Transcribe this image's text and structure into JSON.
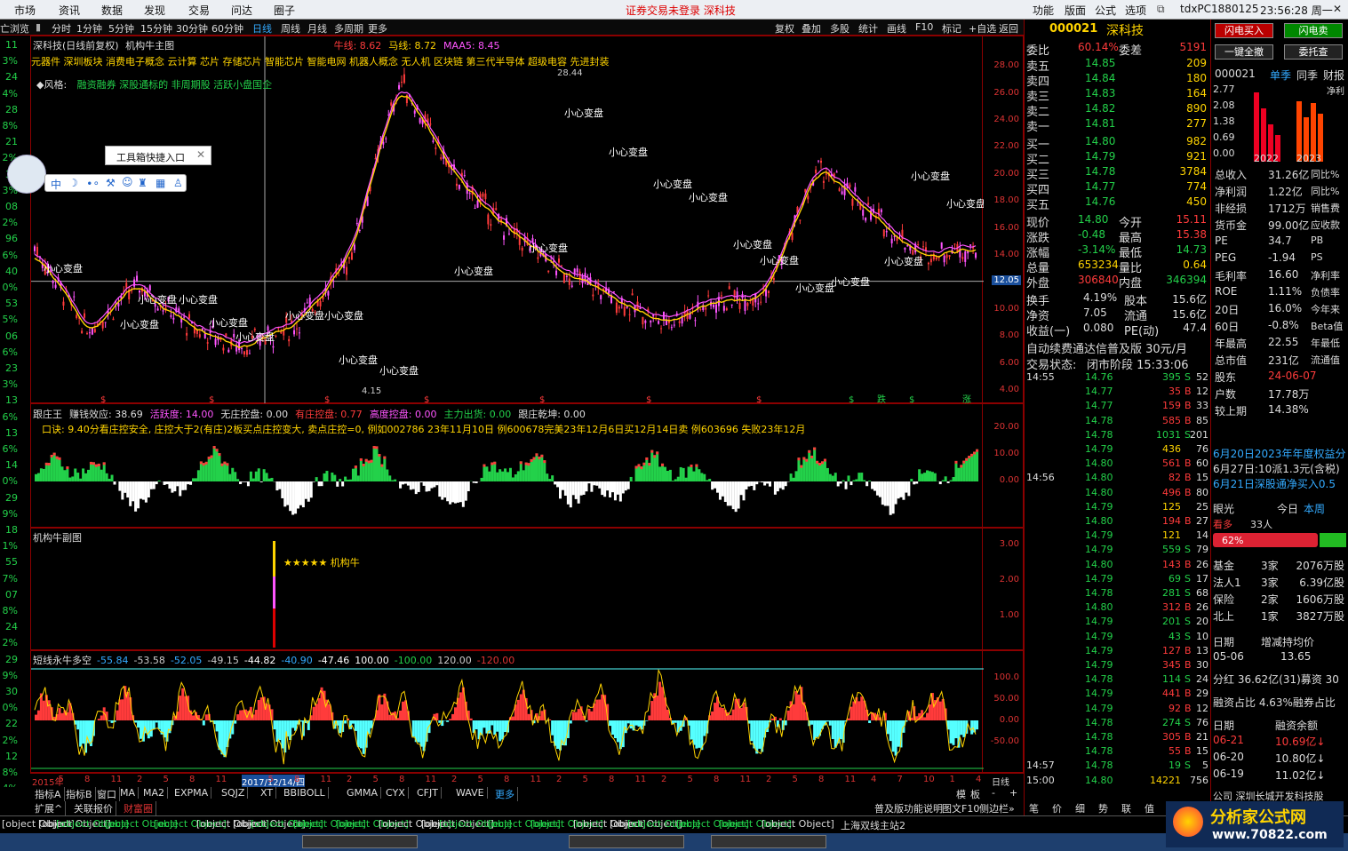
{
  "menu": {
    "items": [
      "市场",
      "资讯",
      "数据",
      "发现",
      "交易",
      "问达",
      "圈子"
    ],
    "center": "证券交易未登录  深科技",
    "right": [
      "功能",
      "版面",
      "公式",
      "选项"
    ],
    "account": "tdxPC1880125",
    "clock": "23:56:28 周一"
  },
  "toolbar": {
    "periods": [
      "分时",
      "1分钟",
      "5分钟",
      "15分钟",
      "30分钟",
      "60分钟",
      "日线",
      "周线",
      "月线",
      "多周期",
      "更多"
    ],
    "active_period": "日线",
    "tools": [
      "复权",
      "叠加",
      "多股",
      "统计",
      "画线",
      "F10",
      "标记",
      "+自选",
      "返回"
    ]
  },
  "left_column": {
    "label": "亡浏览",
    "values": [
      "11",
      "3%",
      "24",
      "4%",
      "28",
      "8%",
      "21",
      "2%",
      "36",
      "3%",
      "08",
      "2%",
      "96",
      "6%",
      "40",
      "0%",
      "53",
      "5%",
      "06",
      "6%",
      "23",
      "3%",
      "13",
      "6%",
      "13",
      "6%",
      "14",
      "0%",
      "29",
      "9%",
      "18",
      "1%",
      "55",
      "7%",
      "07",
      "8%",
      "24",
      "2%",
      "29",
      "9%",
      "30",
      "0%",
      "22",
      "2%",
      "12",
      "8%",
      "4%"
    ]
  },
  "main_chart": {
    "title": "深科技(日线前复权)",
    "indicator": "机构牛主图",
    "legend": [
      {
        "label": "牛线: 8.62",
        "color": "#ff3b3b"
      },
      {
        "label": "马线: 8.72",
        "color": "#ffd400"
      },
      {
        "label": "MAA5: 8.45",
        "color": "#ff55ff"
      }
    ],
    "concepts": "元器件 深圳板块 消费电子概念 云计算 芯片 存储芯片 智能芯片 智能电网 机器人概念 无人机 区块链 第三代半导体 超级电容 先进封装",
    "style_label": "◆风格:",
    "style_value": "融资融券 深股通标的 非周期股 活跃小盘国企",
    "annotations": [
      "小心变盘",
      "小心变盘",
      "小心变盘",
      "小心变盘",
      "小心变盘",
      "小心变盘",
      "小心变盘",
      "小心变盘",
      "小心变盘",
      "小心变盘",
      "小心变盘",
      "小心变盘",
      "小心变盘",
      "小心变盘",
      "小心变盘",
      "小心变盘"
    ],
    "high_label": "28.44",
    "low_label": "4.15",
    "crosshair_price": "12.05",
    "y_ticks": [
      "28.00",
      "26.00",
      "24.00",
      "22.00",
      "20.00",
      "18.00",
      "16.00",
      "14.00",
      "12.00",
      "10.00",
      "8.00",
      "6.00",
      "4.00"
    ],
    "markers": [
      "$",
      "$",
      "$",
      "$",
      "$",
      "$",
      "$",
      "$",
      "跌",
      "$",
      "涨",
      "减"
    ]
  },
  "chart_data": [
    {
      "type": "line",
      "title": "深科技(日线前复权)",
      "ylim": [
        4,
        29
      ],
      "x": [
        "2015",
        "2016",
        "2017",
        "2018",
        "2019",
        "2020",
        "2021",
        "2022",
        "2023",
        "2024"
      ],
      "series": [
        {
          "name": "牛线",
          "values": [
            14.6,
            8.4,
            11.8,
            8.6,
            7.2,
            8.8,
            13.5,
            27.0,
            20.0,
            16.0,
            13.0,
            11.0,
            9.0,
            10.5,
            11.2,
            20.5,
            17.0,
            14.0,
            14.6
          ]
        }
      ]
    },
    {
      "type": "bar",
      "title": "跟庄王",
      "ylim": [
        -5,
        21
      ],
      "y_ticks": [
        "20.00",
        "10.00",
        "0.00"
      ]
    },
    {
      "type": "bar",
      "title": "机构牛副图",
      "ylim": [
        0,
        3.2
      ],
      "y_ticks": [
        "3.00",
        "2.00",
        "1.00"
      ],
      "label": "★★★★★ 机构牛"
    },
    {
      "type": "area",
      "title": "短线永牛多空",
      "ylim": [
        -100,
        110
      ],
      "y_ticks": [
        "100.0",
        "50.00",
        "0.00",
        "-50.00"
      ]
    }
  ],
  "gzw": {
    "title": "跟庄王",
    "items": [
      {
        "t": "赚钱效应: 38.69",
        "c": "#ddd"
      },
      {
        "t": "活跃度: 14.00",
        "c": "#ff55ff"
      },
      {
        "t": "无庄控盘: 0.00",
        "c": "#ddd"
      },
      {
        "t": "有庄控盘: 0.77",
        "c": "#ff3b3b"
      },
      {
        "t": "高度控盘: 0.00",
        "c": "#ff55ff"
      },
      {
        "t": "主力出货: 0.00",
        "c": "#23d14a"
      },
      {
        "t": "跟庄乾坤: 0.00",
        "c": "#ddd"
      }
    ],
    "tip": "口诀: 9.40分看庄控安全, 庄控大于2(有庄)2板买点庄控变大, 卖点庄控=0, 例如002786 23年11月10日 例600678完美23年12月6日买12月14日卖 例603696 失败23年12月"
  },
  "jgn": {
    "title": "机构牛副图",
    "label": "★★★★★ 机构牛"
  },
  "dx": {
    "title": "短线永牛多空",
    "values": [
      "-55.84",
      "-53.58",
      "-52.05",
      "-49.15",
      "-44.82",
      "-40.90",
      "-47.46",
      "100.00",
      "-100.00",
      "120.00",
      "-120.00"
    ]
  },
  "date_axis": {
    "labels": [
      "2015年",
      "5",
      "8",
      "11",
      "2",
      "5",
      "8",
      "11",
      "2017/12/14/四",
      "5",
      "8",
      "11",
      "2",
      "5",
      "8",
      "11",
      "2",
      "5",
      "8",
      "11",
      "2",
      "5",
      "8",
      "11",
      "2",
      "5",
      "8",
      "11",
      "2",
      "5",
      "8",
      "11",
      "4",
      "7",
      "10",
      "1",
      "4"
    ],
    "period": "日线"
  },
  "bottom_tabs": {
    "row1": [
      "指标A",
      "指标B",
      "窗口",
      "MA",
      "MA2",
      "EXPMA",
      "SQJZ",
      "XT",
      "BBIBOLL",
      "GMMA",
      "CYX",
      "CFJT",
      "WAVE",
      "更多"
    ],
    "row2": [
      "扩展^",
      "关联报价",
      "财富圈"
    ],
    "right": [
      "模",
      "板",
      "-",
      "+"
    ]
  },
  "toolbox": {
    "title": "工具箱快捷入口"
  },
  "quote": {
    "code": "000021",
    "name": "深科技",
    "weibi": "委比",
    "weibi_val": "60.14%",
    "weicha": "委差",
    "weicha_val": "5191",
    "asks": [
      {
        "l": "卖五",
        "p": "14.85",
        "v": "209"
      },
      {
        "l": "卖四",
        "p": "14.84",
        "v": "180"
      },
      {
        "l": "卖三",
        "p": "14.83",
        "v": "164"
      },
      {
        "l": "卖二",
        "p": "14.82",
        "v": "890"
      },
      {
        "l": "卖一",
        "p": "14.81",
        "v": "277"
      }
    ],
    "bids": [
      {
        "l": "买一",
        "p": "14.80",
        "v": "982"
      },
      {
        "l": "买二",
        "p": "14.79",
        "v": "921"
      },
      {
        "l": "买三",
        "p": "14.78",
        "v": "3784"
      },
      {
        "l": "买四",
        "p": "14.77",
        "v": "774"
      },
      {
        "l": "买五",
        "p": "14.76",
        "v": "450"
      }
    ],
    "stats": [
      [
        "现价",
        "14.80",
        "今开",
        "15.11"
      ],
      [
        "涨跌",
        "-0.48",
        "最高",
        "15.38"
      ],
      [
        "涨幅",
        "-3.14%",
        "最低",
        "14.73"
      ],
      [
        "总量",
        "653234",
        "量比",
        "0.64"
      ],
      [
        "外盘",
        "306840",
        "内盘",
        "346394"
      ]
    ],
    "stats2": [
      [
        "换手",
        "4.19%",
        "股本",
        "15.6亿"
      ],
      [
        "净资",
        "7.05",
        "流通",
        "15.6亿"
      ],
      [
        "收益(一)",
        "0.080",
        "PE(动)",
        "47.4"
      ]
    ],
    "promo": "自动续费通达信普及版 30元/月",
    "status_label": "交易状态:",
    "status_val": "闭市阶段 15:33:06"
  },
  "ticks": [
    {
      "t": "14:55",
      "p": "14.76",
      "v": "395",
      "s": "S",
      "n": "52"
    },
    {
      "t": "",
      "p": "14.77",
      "v": "35",
      "s": "B",
      "n": "12"
    },
    {
      "t": "",
      "p": "14.77",
      "v": "159",
      "s": "B",
      "n": "33"
    },
    {
      "t": "",
      "p": "14.78",
      "v": "585",
      "s": "B",
      "n": "85"
    },
    {
      "t": "",
      "p": "14.78",
      "v": "1031",
      "s": "S",
      "n": "201"
    },
    {
      "t": "",
      "p": "14.79",
      "v": "436",
      "s": "",
      "n": "76"
    },
    {
      "t": "",
      "p": "14.80",
      "v": "561",
      "s": "B",
      "n": "60"
    },
    {
      "t": "14:56",
      "p": "14.80",
      "v": "82",
      "s": "B",
      "n": "15"
    },
    {
      "t": "",
      "p": "14.80",
      "v": "496",
      "s": "B",
      "n": "80"
    },
    {
      "t": "",
      "p": "14.79",
      "v": "125",
      "s": "",
      "n": "25"
    },
    {
      "t": "",
      "p": "14.80",
      "v": "194",
      "s": "B",
      "n": "27"
    },
    {
      "t": "",
      "p": "14.79",
      "v": "121",
      "s": "",
      "n": "14"
    },
    {
      "t": "",
      "p": "14.79",
      "v": "559",
      "s": "S",
      "n": "79"
    },
    {
      "t": "",
      "p": "14.80",
      "v": "143",
      "s": "B",
      "n": "26"
    },
    {
      "t": "",
      "p": "14.79",
      "v": "69",
      "s": "S",
      "n": "17"
    },
    {
      "t": "",
      "p": "14.78",
      "v": "281",
      "s": "S",
      "n": "68"
    },
    {
      "t": "",
      "p": "14.80",
      "v": "312",
      "s": "B",
      "n": "26"
    },
    {
      "t": "",
      "p": "14.79",
      "v": "201",
      "s": "S",
      "n": "20"
    },
    {
      "t": "",
      "p": "14.79",
      "v": "43",
      "s": "S",
      "n": "10"
    },
    {
      "t": "",
      "p": "14.79",
      "v": "127",
      "s": "B",
      "n": "13"
    },
    {
      "t": "",
      "p": "14.79",
      "v": "345",
      "s": "B",
      "n": "30"
    },
    {
      "t": "",
      "p": "14.78",
      "v": "114",
      "s": "S",
      "n": "24"
    },
    {
      "t": "",
      "p": "14.79",
      "v": "441",
      "s": "B",
      "n": "29"
    },
    {
      "t": "",
      "p": "14.79",
      "v": "92",
      "s": "B",
      "n": "12"
    },
    {
      "t": "",
      "p": "14.78",
      "v": "274",
      "s": "S",
      "n": "76"
    },
    {
      "t": "",
      "p": "14.78",
      "v": "305",
      "s": "B",
      "n": "21"
    },
    {
      "t": "",
      "p": "14.78",
      "v": "55",
      "s": "B",
      "n": "15"
    },
    {
      "t": "14:57",
      "p": "14.78",
      "v": "19",
      "s": "S",
      "n": "5"
    },
    {
      "t": "15:00",
      "p": "14.80",
      "v": "14221",
      "s": "",
      "n": "756"
    }
  ],
  "f10": {
    "btn_buy": "闪电买入",
    "btn_sell": "闪电卖",
    "btn_onekey": "一键全撤",
    "btn_trust": "委托查",
    "code": "000021",
    "tabs": [
      "单季",
      "同季",
      "财报"
    ],
    "netpro": "净利",
    "bar_vals": [
      "2.77",
      "2.08",
      "1.38",
      "0.69",
      "0.00"
    ],
    "years": [
      "2022",
      "2023"
    ],
    "rows": [
      [
        "总收入",
        "31.26亿",
        "同比%"
      ],
      [
        "净利润",
        "1.22亿",
        "同比%"
      ],
      [
        "非经损",
        "1712万",
        "销售费"
      ],
      [
        "货币金",
        "99.00亿",
        "应收款"
      ],
      [
        "PE",
        "34.7",
        "PB"
      ],
      [
        "PEG",
        "-1.94",
        "PS"
      ],
      [
        "毛利率",
        "16.60",
        "净利率"
      ],
      [
        "ROE",
        "1.11%",
        "负债率"
      ],
      [
        "20日",
        "16.0%",
        "今年来"
      ],
      [
        "60日",
        "-0.8%",
        "Beta值"
      ],
      [
        "年最高",
        "22.55",
        "年最低"
      ],
      [
        "总市值",
        "231亿",
        "流通值"
      ],
      [
        "股东",
        "24-06-07",
        ""
      ],
      [
        "户数",
        "17.78万",
        ""
      ],
      [
        "较上期",
        "14.38%",
        ""
      ]
    ],
    "events": [
      "6月20日2023年年度权益分",
      "6月27日:10派1.3元(含税)",
      "6月21日深股通净买入0.5"
    ],
    "eye": "眼光",
    "today": "今日",
    "week": "本周",
    "bull": "看多",
    "bull_count": "33人",
    "bull_pct": "62%",
    "inst": [
      [
        "基金",
        "3家",
        "2076万股"
      ],
      [
        "法人1",
        "3家",
        "6.39亿股"
      ],
      [
        "保险",
        "2家",
        "1606万股"
      ],
      [
        "北上",
        "1家",
        "3827万股"
      ]
    ],
    "date_h": "日期",
    "inc_h": "增减持均价",
    "inc_date": "05-06",
    "inc_val": "13.65",
    "fenhong": "分红 36.62亿(31)募资 30",
    "rzzb": "融资占比 4.63%融券占比",
    "rz_h": [
      "日期",
      "融资余额"
    ],
    "rz": [
      [
        "06-21",
        "10.69亿↓"
      ],
      [
        "06-20",
        "10.80亿↓"
      ],
      [
        "06-19",
        "11.02亿↓"
      ]
    ],
    "company": "公司 深圳长城开发科技股"
  },
  "status": {
    "items": [
      {
        "t": "3186亿",
        "c": "#ddd"
      },
      {
        "t": "深证",
        "c": "#ddd"
      },
      {
        "t": "8924.17",
        "c": "#23d14a"
      },
      {
        "t": "-140.68",
        "c": "#23d14a"
      },
      {
        "t": "-1.55%",
        "c": "#23d14a"
      },
      {
        "t": "3770亿",
        "c": "#ddd"
      },
      {
        "t": "科创",
        "c": "#ddd"
      },
      {
        "t": "739.14",
        "c": "#23d14a"
      },
      {
        "t": "-19.23",
        "c": "#23d14a"
      },
      {
        "t": "-2.54%",
        "c": "#23d14a"
      },
      {
        "t": "604.4亿",
        "c": "#ddd"
      },
      {
        "t": "沪深",
        "c": "#ddd"
      },
      {
        "t": "3476.81",
        "c": "#23d14a"
      },
      {
        "t": "-18.81",
        "c": "#23d14a"
      },
      {
        "t": "-0.54%",
        "c": "#23d14a"
      },
      {
        "t": "1958亿",
        "c": "#ddd"
      },
      {
        "t": "创业",
        "c": "#ddd"
      },
      {
        "t": "1731.51",
        "c": "#23d14a"
      },
      {
        "t": "-24.37",
        "c": "#23d14a"
      },
      {
        "t": "-1.39%",
        "c": "#23d14a"
      },
      {
        "t": "1743亿",
        "c": "#ddd"
      }
    ],
    "server": "上海双线主站2",
    "extra": [
      "普及版功能说明",
      "图文F10",
      "侧边栏»"
    ],
    "right_tabs": [
      "笔",
      "价",
      "细",
      "势",
      "联",
      "值"
    ]
  },
  "watermark": "分析家公式网www.70822.com",
  "brand": {
    "name": "分析家公式网",
    "url": "www.70822.com"
  }
}
